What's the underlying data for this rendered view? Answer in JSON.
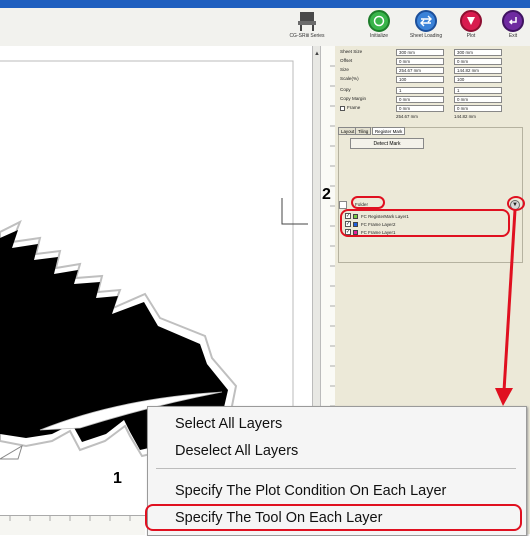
{
  "toolbar": {
    "buttons": [
      {
        "label": "CG-SRⅢ Series",
        "icon": "plotter-icon"
      },
      {
        "label": "Initialize",
        "icon": "initialize-icon"
      },
      {
        "label": "Sheet Loading",
        "icon": "sheet-loading-icon"
      },
      {
        "label": "Plot",
        "icon": "plot-icon"
      },
      {
        "label": "Exit",
        "icon": "exit-icon"
      }
    ]
  },
  "properties": {
    "rows": [
      {
        "label": "Sheet Size",
        "v1": "300 mm",
        "v2": "300 mm"
      },
      {
        "label": "Offset",
        "v1": "0 mm",
        "v2": "0 mm"
      },
      {
        "label": "Size",
        "v1": "254.67 mm",
        "v2": "144.82 mm"
      },
      {
        "label": "Scale(%)",
        "v1": "100",
        "v2": "100"
      },
      {
        "label": "Copy",
        "v1": "1",
        "v2": "1"
      },
      {
        "label": "Copy Margin",
        "v1": "0 mm",
        "v2": "0 mm"
      },
      {
        "label": "Frame",
        "v1": "0 mm",
        "v2": "0 mm"
      }
    ],
    "totals": {
      "x": "254.67 mm",
      "y": "144.82 mm"
    }
  },
  "tabs": [
    "Layout",
    "Tiling",
    "Register Mark"
  ],
  "detect_mark_label": "Detect Mark",
  "layers": {
    "folder_label": "Folder",
    "items": [
      {
        "name": "FC RegisterMark Layer1",
        "color": "#7ac943"
      },
      {
        "name": "FC Frame Layer2",
        "color": "#1f5fe0"
      },
      {
        "name": "FC Frame Layer1",
        "color": "#e0209a"
      }
    ]
  },
  "context_menu": {
    "items": [
      "Select All Layers",
      "Deselect All Layers",
      "Specify The Plot Condition On Each Layer",
      "Specify The Tool On Each Layer"
    ]
  },
  "callouts": {
    "one": "1",
    "two": "2"
  },
  "colors": {
    "annotation_red": "#e01020",
    "title_blue": "#1f5fbf"
  }
}
